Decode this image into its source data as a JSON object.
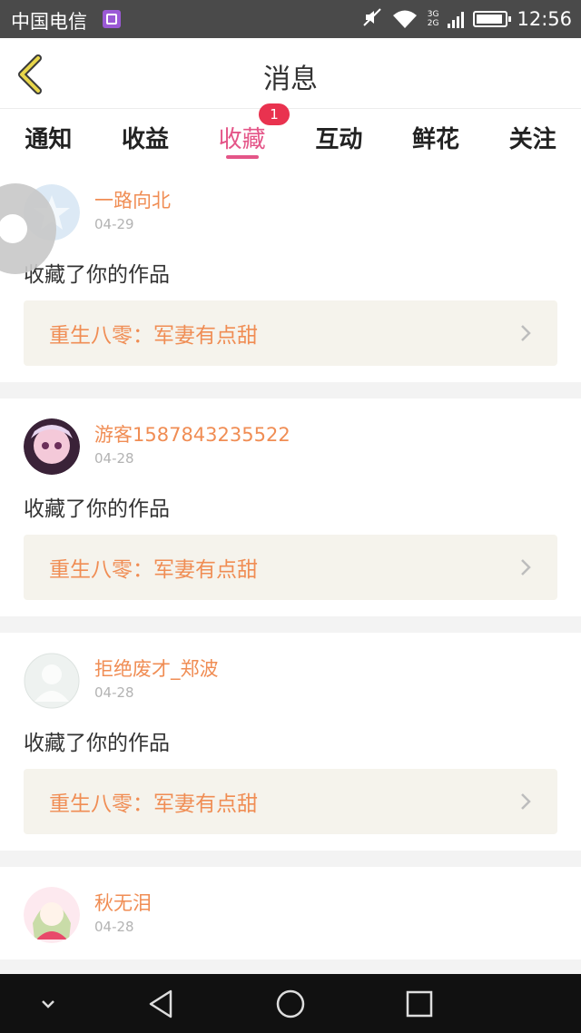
{
  "status_bar": {
    "carrier": "中国电信",
    "network_type_top": "3G",
    "network_type_bottom": "2G",
    "time": "12:56"
  },
  "header": {
    "title": "消息"
  },
  "tabs": [
    {
      "label": "通知",
      "active": false
    },
    {
      "label": "收益",
      "active": false
    },
    {
      "label": "收藏",
      "active": true
    },
    {
      "label": "互动",
      "active": false
    },
    {
      "label": "鲜花",
      "active": false
    },
    {
      "label": "关注",
      "active": false
    }
  ],
  "tab_badge": "1",
  "messages": [
    {
      "user": "一路向北",
      "date": "04-29",
      "action": "收藏了你的作品",
      "work": "重生八零：军妻有点甜",
      "avatar": "default-star-avatar"
    },
    {
      "user": "游客1587843235522",
      "date": "04-28",
      "action": "收藏了你的作品",
      "work": "重生八零：军妻有点甜",
      "avatar": "anime-avatar"
    },
    {
      "user": "拒绝废才_郑波",
      "date": "04-28",
      "action": "收藏了你的作品",
      "work": "重生八零：军妻有点甜",
      "avatar": "silhouette-avatar"
    },
    {
      "user": "秋无泪",
      "date": "04-28",
      "action": "",
      "work": "",
      "avatar": "anime-girl-avatar"
    }
  ],
  "colors": {
    "accent": "#e45588",
    "username": "#f08d54",
    "badge": "#e9324f",
    "work_bg": "#f5f3ec"
  }
}
